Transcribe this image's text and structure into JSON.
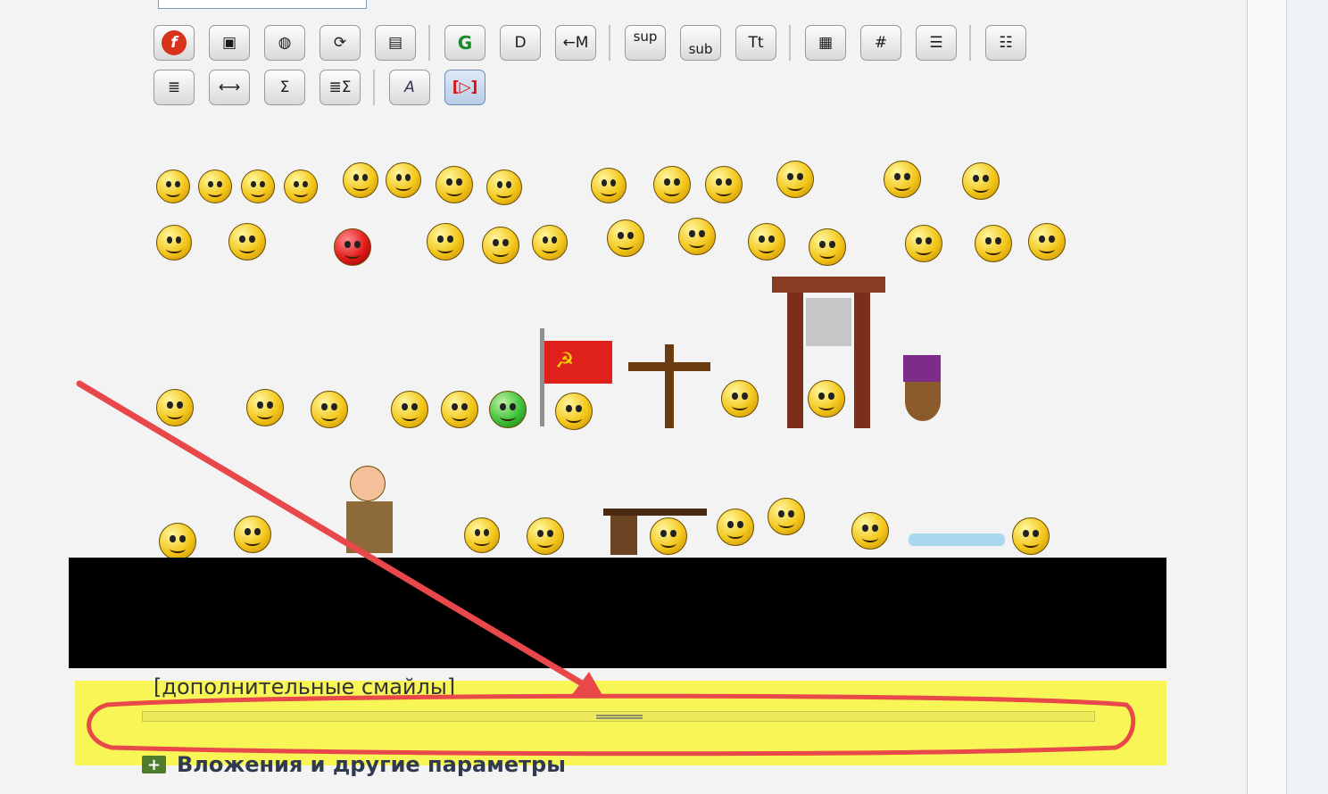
{
  "toolbar": {
    "row1": [
      {
        "name": "flash-button",
        "glyph": "f",
        "icon": "flash-icon"
      },
      {
        "name": "image-button",
        "glyph": "▣",
        "icon": "image-icon"
      },
      {
        "name": "web-link-button",
        "glyph": "◍",
        "icon": "globe-icon"
      },
      {
        "name": "refresh-button",
        "glyph": "⟳",
        "icon": "refresh-icon"
      },
      {
        "name": "web-folder-button",
        "glyph": "▤",
        "icon": "web-folder-icon"
      },
      {
        "name": "google-button",
        "glyph": "G",
        "icon": "google-icon"
      },
      {
        "name": "wiki-button",
        "glyph": "D",
        "icon": "wiki-icon"
      },
      {
        "name": "move-left-button",
        "glyph": "←M",
        "icon": "arrow-left-icon"
      },
      {
        "name": "superscript-button",
        "glyph": "sup",
        "icon": "superscript-icon"
      },
      {
        "name": "subscript-button",
        "glyph": "sub",
        "icon": "subscript-icon"
      },
      {
        "name": "typewriter-button",
        "glyph": "Tt",
        "icon": "typewriter-icon"
      },
      {
        "name": "table-button",
        "glyph": "▦",
        "icon": "table-icon"
      },
      {
        "name": "hash-button",
        "glyph": "#",
        "icon": "hash-icon"
      },
      {
        "name": "comment-button",
        "glyph": "☰",
        "icon": "comment-icon"
      },
      {
        "name": "bullet-list-button",
        "glyph": "☷",
        "icon": "bullet-list-icon"
      }
    ],
    "row2": [
      {
        "name": "numbered-list-button",
        "glyph": "≣",
        "icon": "numbered-list-icon"
      },
      {
        "name": "horizontal-rule-button",
        "glyph": "⟷",
        "icon": "horizontal-rule-icon"
      },
      {
        "name": "sum-button",
        "glyph": "Σ",
        "icon": "sum-icon"
      },
      {
        "name": "sum-list-button",
        "glyph": "≣Σ",
        "icon": "sum-list-icon"
      },
      {
        "name": "font-button",
        "glyph": "A",
        "icon": "font-icon"
      },
      {
        "name": "select-button",
        "glyph": "[▷]",
        "icon": "select-icon"
      }
    ]
  },
  "smileys": {
    "more_link": "[дополнительные смайлы]"
  },
  "attachments": {
    "label": "Вложения и другие параметры"
  },
  "colors": {
    "highlight": "#f8f557",
    "annotation": "#e9484a"
  }
}
